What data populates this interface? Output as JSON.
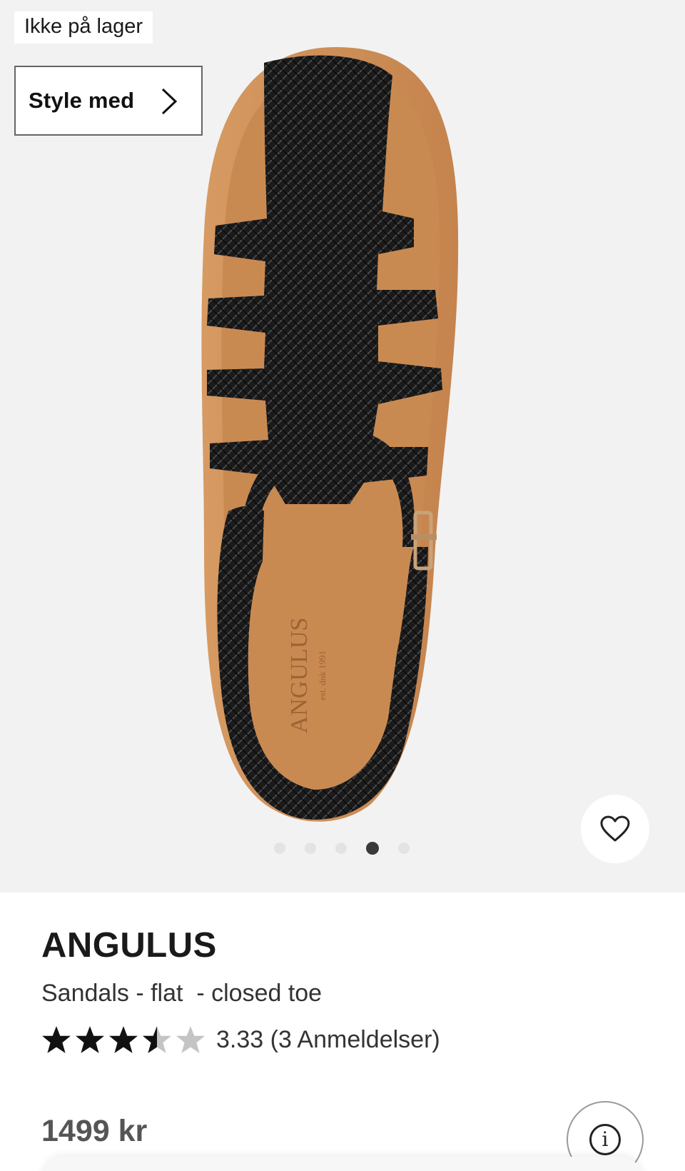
{
  "gallery": {
    "stock_badge": "Ikke på lager",
    "style_button_label": "Style med",
    "image_index_active": 4,
    "image_count": 5,
    "colors": {
      "background": "#f2f2f2",
      "leather": "#1b1b1b",
      "insole": "#c98a52"
    }
  },
  "sandal": {
    "insole_logo": "ANGULUS",
    "insole_sub": "est. dnk 1991"
  },
  "product": {
    "brand": "ANGULUS",
    "category": "Sandals - flat  - closed toe",
    "rating_value": 3.33,
    "rating_text": "3.33 (3 Anmeldelser)",
    "price": "1499 kr"
  },
  "icons": {
    "style_chevron": "chevron-right-icon",
    "favorite": "heart-icon",
    "info": "info-icon",
    "rating": "star-icon"
  },
  "theme": {
    "star_filled": "#111111",
    "star_empty": "#c4c4c4"
  }
}
